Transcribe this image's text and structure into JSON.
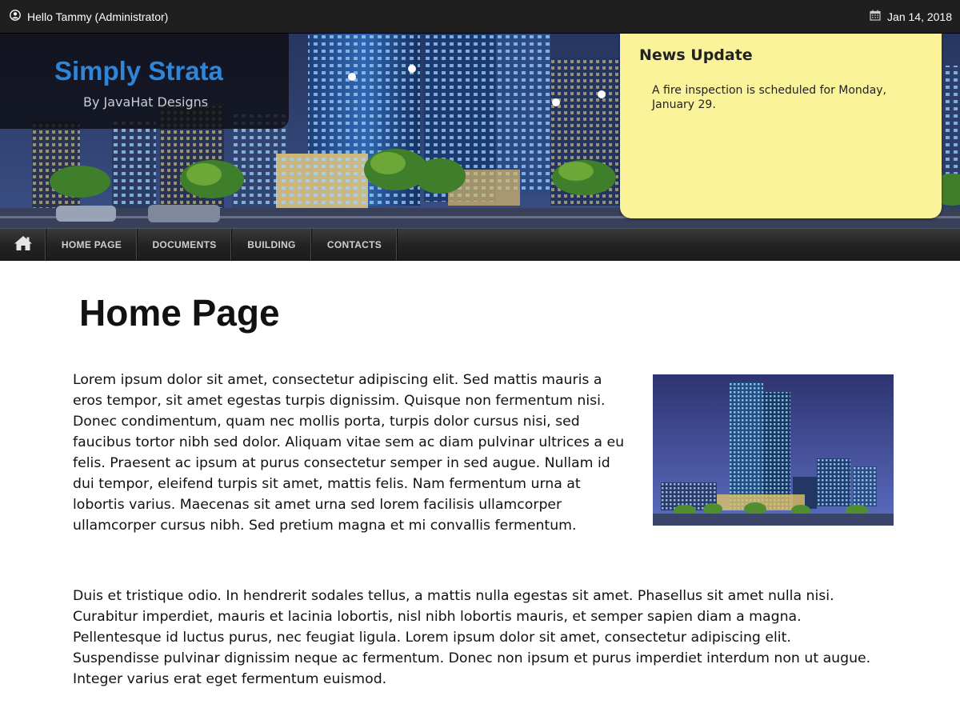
{
  "topbar": {
    "greeting": "Hello Tammy (Administrator)",
    "date": "Jan 14, 2018",
    "user_icon": "user-circle-icon",
    "calendar_icon": "calendar-icon"
  },
  "brand": {
    "title": "Simply Strata",
    "subtitle": "By JavaHat Designs"
  },
  "news": {
    "title": "News Update",
    "body": "A fire inspection is scheduled for Monday, January 29."
  },
  "nav": {
    "home_icon": "home-icon",
    "items": [
      "HOME PAGE",
      "DOCUMENTS",
      "BUILDING",
      "CONTACTS"
    ]
  },
  "main": {
    "title": "Home Page",
    "paragraph1": "Lorem ipsum dolor sit amet, consectetur adipiscing elit. Sed mattis mauris a eros tempor, sit amet egestas turpis dignissim. Quisque non fermentum nisi. Donec condimentum, quam nec mollis porta, turpis dolor cursus nisi, sed faucibus tortor nibh sed dolor. Aliquam vitae sem ac diam pulvinar ultrices a eu felis. Praesent ac ipsum at purus consectetur semper in sed augue. Nullam id dui tempor, eleifend turpis sit amet, mattis felis. Nam fermentum urna at lobortis varius. Maecenas sit amet urna sed lorem facilisis ullamcorper ullamcorper cursus nibh. Sed pretium magna et mi convallis fermentum.",
    "paragraph2": "Duis et tristique odio. In hendrerit sodales tellus, a mattis nulla egestas sit amet. Phasellus sit amet nulla nisi. Curabitur imperdiet, mauris et lacinia lobortis, nisl nibh lobortis mauris, et semper sapien diam a magna. Pellentesque id luctus purus, nec feugiat ligula. Lorem ipsum dolor sit amet, consectetur adipiscing elit. Suspendisse pulvinar dignissim neque ac fermentum. Donec non ipsum et purus imperdiet interdum non ut augue. Integer varius erat eget fermentum euismod."
  },
  "colors": {
    "brand_blue": "#2f86d9",
    "news_yellow": "#fbf39a",
    "topbar_bg": "#1f1f1f",
    "nav_bg": "#222222"
  }
}
